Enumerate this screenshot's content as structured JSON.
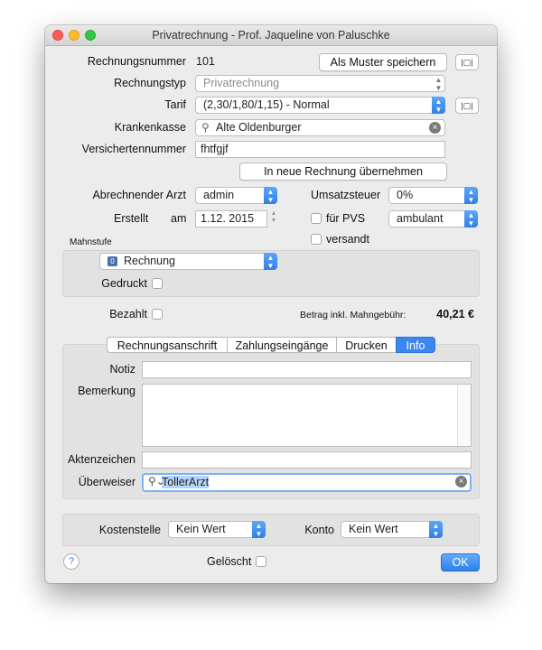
{
  "window": {
    "title": "Privatrechnung - Prof. Jaqueline von  Paluschke",
    "traffic_colors": {
      "close": "#fc5f57",
      "minimize": "#fdbc2e",
      "zoom": "#33c748"
    }
  },
  "invoice": {
    "number_label": "Rechnungsnummer",
    "number_value": "101",
    "save_template_label": "Als Muster speichern",
    "type_label": "Rechnungstyp",
    "type_value": "Privatrechnung",
    "tarif_label": "Tarif",
    "tarif_value": "(2,30/1,80/1,15)  -  Normal",
    "insurance_label": "Krankenkasse",
    "insurance_value": "Alte Oldenburger",
    "insured_number_label": "Versichertennummer",
    "insured_number_value": "fhtfgjf",
    "apply_button_label": "In neue Rechnung übernehmen"
  },
  "billing": {
    "doctor_label": "Abrechnender Arzt",
    "doctor_value": "admin",
    "vat_label": "Umsatzsteuer",
    "vat_value": "0%",
    "created_label": "Erstellt",
    "created_am": "am",
    "created_date": "1.12. 2015",
    "pvs_label": "für PVS",
    "pvs_checked": false,
    "mode_value": "ambulant",
    "sent_label": "versandt",
    "sent_checked": false
  },
  "dunning": {
    "section_label": "Mahnstufe",
    "level_badge": "0",
    "level_value": "Rechnung",
    "printed_label": "Gedruckt",
    "printed_checked": false
  },
  "payment": {
    "paid_label": "Bezahlt",
    "paid_checked": false,
    "amount_label": "Betrag inkl. Mahngebühr:",
    "amount_value": "40,21 €"
  },
  "tabs": [
    {
      "label": "Rechnungsanschrift",
      "active": false
    },
    {
      "label": "Zahlungseingänge",
      "active": false
    },
    {
      "label": "Drucken",
      "active": false
    },
    {
      "label": "Info",
      "active": true
    }
  ],
  "info": {
    "note_label": "Notiz",
    "note_value": "",
    "remark_label": "Bemerkung",
    "remark_value": "",
    "reference_label": "Aktenzeichen",
    "reference_value": "",
    "referrer_label": "Überweiser",
    "referrer_value": "TollerArzt"
  },
  "footer": {
    "cost_center_label": "Kostenstelle",
    "cost_center_value": "Kein Wert",
    "account_label": "Konto",
    "account_value": "Kein Wert",
    "help_label": "?",
    "deleted_label": "Gelöscht",
    "deleted_checked": false,
    "ok_label": "OK"
  },
  "colors": {
    "accent": "#2f7fe8",
    "window_bg": "#ececec",
    "panel_bg": "#e2e2e2",
    "selection": "#b3d4fd"
  },
  "icons": {
    "template": "template-card-icon",
    "search": "search-icon",
    "clear": "clear-icon",
    "help": "help-icon"
  }
}
